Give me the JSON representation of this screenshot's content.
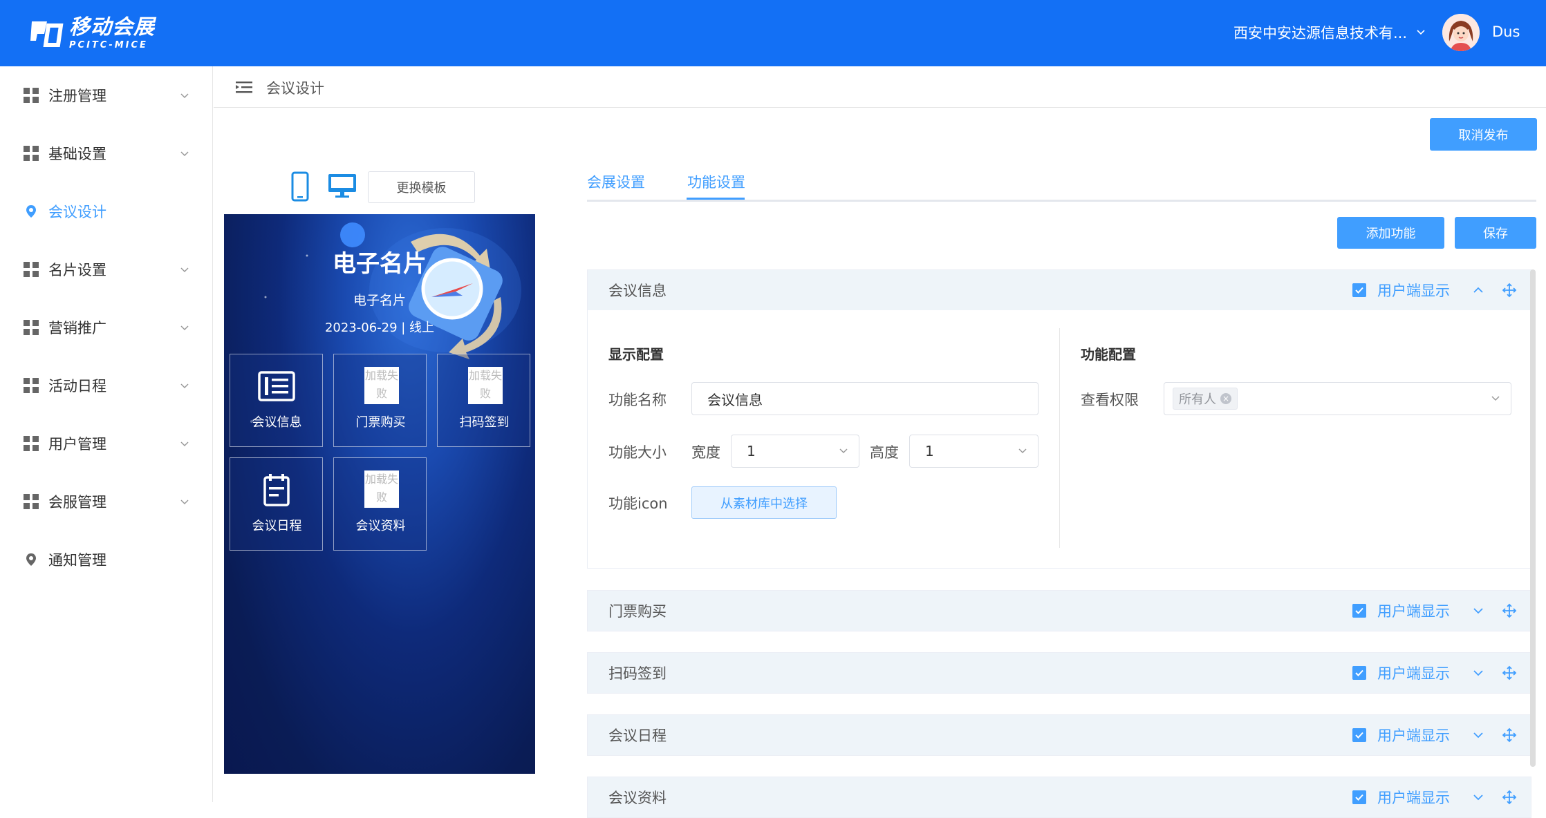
{
  "header": {
    "logo_cn": "移动会展",
    "logo_en": "PCITC-MICE",
    "org_name": "西安中安达源信息技术有...",
    "user_name": "Dus",
    "brand_color": "#1370f5"
  },
  "sidebar": {
    "items": [
      {
        "label": "注册管理",
        "icon": "grid-icon",
        "active": false
      },
      {
        "label": "基础设置",
        "icon": "grid-icon",
        "active": false
      },
      {
        "label": "会议设计",
        "icon": "location-icon",
        "active": true
      },
      {
        "label": "名片设置",
        "icon": "grid-icon",
        "active": false
      },
      {
        "label": "营销推广",
        "icon": "grid-icon",
        "active": false
      },
      {
        "label": "活动日程",
        "icon": "grid-icon",
        "active": false
      },
      {
        "label": "用户管理",
        "icon": "grid-icon",
        "active": false
      },
      {
        "label": "会服管理",
        "icon": "grid-icon",
        "active": false
      },
      {
        "label": "通知管理",
        "icon": "location-icon",
        "active": false
      }
    ]
  },
  "breadcrumb": {
    "current": "会议设计"
  },
  "toolbar": {
    "unpublish_label": "取消发布",
    "change_template_label": "更换模板"
  },
  "preview": {
    "title": "电子名片",
    "subtitle": "电子名片",
    "date_line": "2023-06-29 | 线上",
    "broken_image_text": "加载失败",
    "tiles": [
      {
        "label": "会议信息",
        "icon": "info-list-icon"
      },
      {
        "label": "门票购买",
        "icon": "broken-image-icon"
      },
      {
        "label": "扫码签到",
        "icon": "broken-image-icon"
      },
      {
        "label": "会议日程",
        "icon": "calendar-icon"
      },
      {
        "label": "会议资料",
        "icon": "broken-image-icon"
      }
    ]
  },
  "tabs": [
    {
      "label": "会展设置",
      "active": false
    },
    {
      "label": "功能设置",
      "active": true
    }
  ],
  "actions": {
    "add_label": "添加功能",
    "save_label": "保存"
  },
  "panels": [
    {
      "name": "会议信息",
      "show_label": "用户端显示",
      "expanded": true
    },
    {
      "name": "门票购买",
      "show_label": "用户端显示",
      "expanded": false
    },
    {
      "name": "扫码签到",
      "show_label": "用户端显示",
      "expanded": false
    },
    {
      "name": "会议日程",
      "show_label": "用户端显示",
      "expanded": false
    },
    {
      "name": "会议资料",
      "show_label": "用户端显示",
      "expanded": false
    }
  ],
  "detail": {
    "display_title": "显示配置",
    "function_title": "功能配置",
    "name_label": "功能名称",
    "name_value": "会议信息",
    "size_label": "功能大小",
    "width_label": "宽度",
    "width_value": "1",
    "height_label": "高度",
    "height_value": "1",
    "icon_label": "功能icon",
    "icon_button": "从素材库中选择",
    "permission_label": "查看权限",
    "permission_tag": "所有人"
  }
}
